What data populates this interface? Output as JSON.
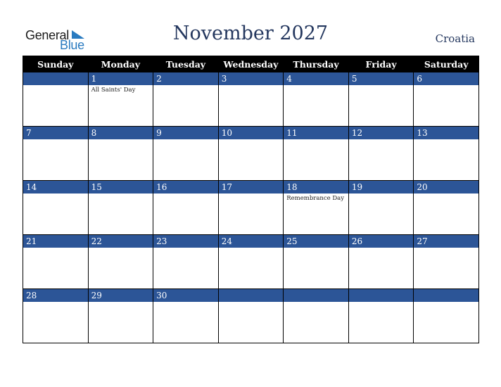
{
  "logo": {
    "line1": "General",
    "line2": "Blue"
  },
  "header": {
    "title": "November 2027",
    "country": "Croatia"
  },
  "weekdays": [
    "Sunday",
    "Monday",
    "Tuesday",
    "Wednesday",
    "Thursday",
    "Friday",
    "Saturday"
  ],
  "weeks": [
    [
      {
        "day": "",
        "event": ""
      },
      {
        "day": "1",
        "event": "All Saints' Day"
      },
      {
        "day": "2",
        "event": ""
      },
      {
        "day": "3",
        "event": ""
      },
      {
        "day": "4",
        "event": ""
      },
      {
        "day": "5",
        "event": ""
      },
      {
        "day": "6",
        "event": ""
      }
    ],
    [
      {
        "day": "7",
        "event": ""
      },
      {
        "day": "8",
        "event": ""
      },
      {
        "day": "9",
        "event": ""
      },
      {
        "day": "10",
        "event": ""
      },
      {
        "day": "11",
        "event": ""
      },
      {
        "day": "12",
        "event": ""
      },
      {
        "day": "13",
        "event": ""
      }
    ],
    [
      {
        "day": "14",
        "event": ""
      },
      {
        "day": "15",
        "event": ""
      },
      {
        "day": "16",
        "event": ""
      },
      {
        "day": "17",
        "event": ""
      },
      {
        "day": "18",
        "event": "Remembrance Day"
      },
      {
        "day": "19",
        "event": ""
      },
      {
        "day": "20",
        "event": ""
      }
    ],
    [
      {
        "day": "21",
        "event": ""
      },
      {
        "day": "22",
        "event": ""
      },
      {
        "day": "23",
        "event": ""
      },
      {
        "day": "24",
        "event": ""
      },
      {
        "day": "25",
        "event": ""
      },
      {
        "day": "26",
        "event": ""
      },
      {
        "day": "27",
        "event": ""
      }
    ],
    [
      {
        "day": "28",
        "event": ""
      },
      {
        "day": "29",
        "event": ""
      },
      {
        "day": "30",
        "event": ""
      },
      {
        "day": "",
        "event": ""
      },
      {
        "day": "",
        "event": ""
      },
      {
        "day": "",
        "event": ""
      },
      {
        "day": "",
        "event": ""
      }
    ]
  ],
  "colors": {
    "band": "#2c5597",
    "title": "#24375e",
    "logo_blue": "#2a7bc0"
  }
}
